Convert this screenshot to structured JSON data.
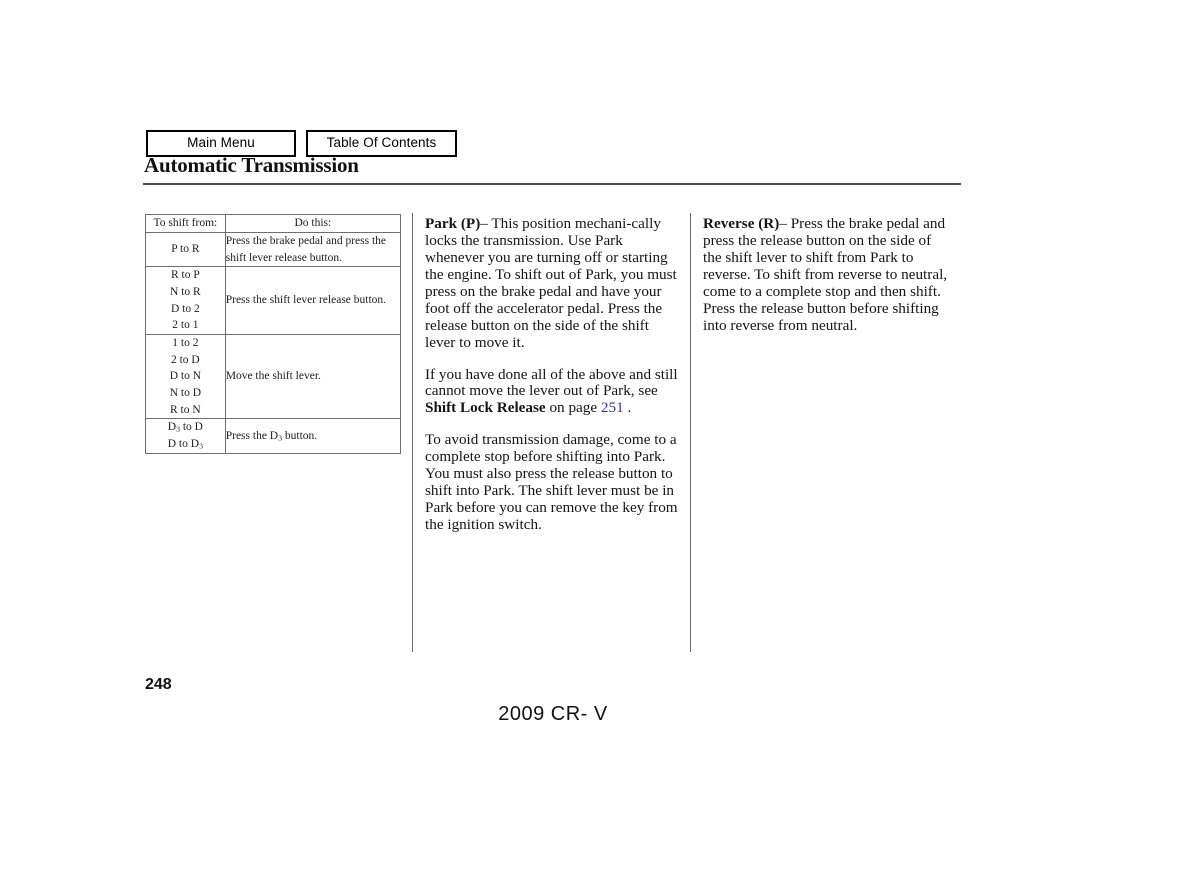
{
  "nav": {
    "main_menu": "Main Menu",
    "table_of_contents": "Table Of Contents"
  },
  "header": {
    "title": "Automatic Transmission"
  },
  "table": {
    "headers": {
      "from": "To shift from:",
      "do": "Do this:"
    },
    "rows": [
      {
        "from": [
          "P to R"
        ],
        "do": "Press the brake pedal and press the shift lever release button."
      },
      {
        "from": [
          "R to P",
          "N to R",
          "D to 2",
          "2 to 1"
        ],
        "do": "Press the shift lever release button."
      },
      {
        "from": [
          "1 to 2",
          "2 to D",
          "D to N",
          "N to D",
          "R to N"
        ],
        "do": "Move the shift lever."
      },
      {
        "from": [
          "D3 to D",
          "D to D3"
        ],
        "do": "Press the D3 button."
      }
    ]
  },
  "middle_column": {
    "para1_lead": "Park (P)",
    "para1_dash": "–",
    "para1_text": " This position mechani-cally locks the transmission. Use Park whenever you are turning off or starting the engine. To shift out of Park, you must press on the brake pedal and have your foot off the accelerator pedal. Press the release button on the side of the shift lever to move it.",
    "para2_pre": "If you have done all of the above and still cannot move the lever out of Park, see ",
    "para2_bold": "Shift Lock Release",
    "para2_mid": " on page ",
    "para2_link": "251",
    "para2_post": " .",
    "para3_text": "To avoid transmission damage, come to a complete stop before shifting into Park. You must also press the release button to shift into Park. The shift lever must be in Park before you can remove the key from the ignition switch."
  },
  "right_column": {
    "para1_lead": "Reverse (R)",
    "para1_dash": "–",
    "para1_text": " Press the brake pedal and press the release button on the side of the shift lever to shift from Park to reverse. To shift from reverse to neutral, come to a complete stop and then shift. Press the release button before shifting into reverse from neutral."
  },
  "footer": {
    "page_number": "248",
    "model": "2009  CR- V"
  }
}
